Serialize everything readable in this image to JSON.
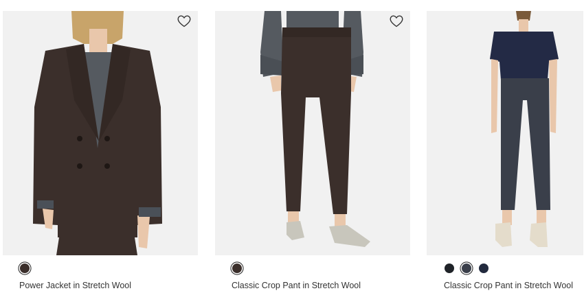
{
  "products": [
    {
      "name": "Power Jacket in Stretch Wool",
      "wishlist_icon": "heart-outline-icon",
      "swatches": [
        {
          "color": "#3b2f2b",
          "selected": true
        }
      ]
    },
    {
      "name": "Classic Crop Pant in Stretch Wool",
      "wishlist_icon": "heart-outline-icon",
      "swatches": [
        {
          "color": "#3b2f2b",
          "selected": true
        }
      ]
    },
    {
      "name": "Classic Crop Pant in Stretch Wool",
      "wishlist_icon": "heart-outline-icon",
      "swatches": [
        {
          "color": "#1f2328",
          "selected": false
        },
        {
          "color": "#3a3f4a",
          "selected": true
        },
        {
          "color": "#222a3e",
          "selected": false
        }
      ]
    }
  ],
  "colors": {
    "image_background": "#f1f1f1",
    "text": "#333333",
    "jacket_brown": "#3b2f2b",
    "pant_charcoal": "#3a3f4a",
    "top_navy": "#232a45"
  }
}
